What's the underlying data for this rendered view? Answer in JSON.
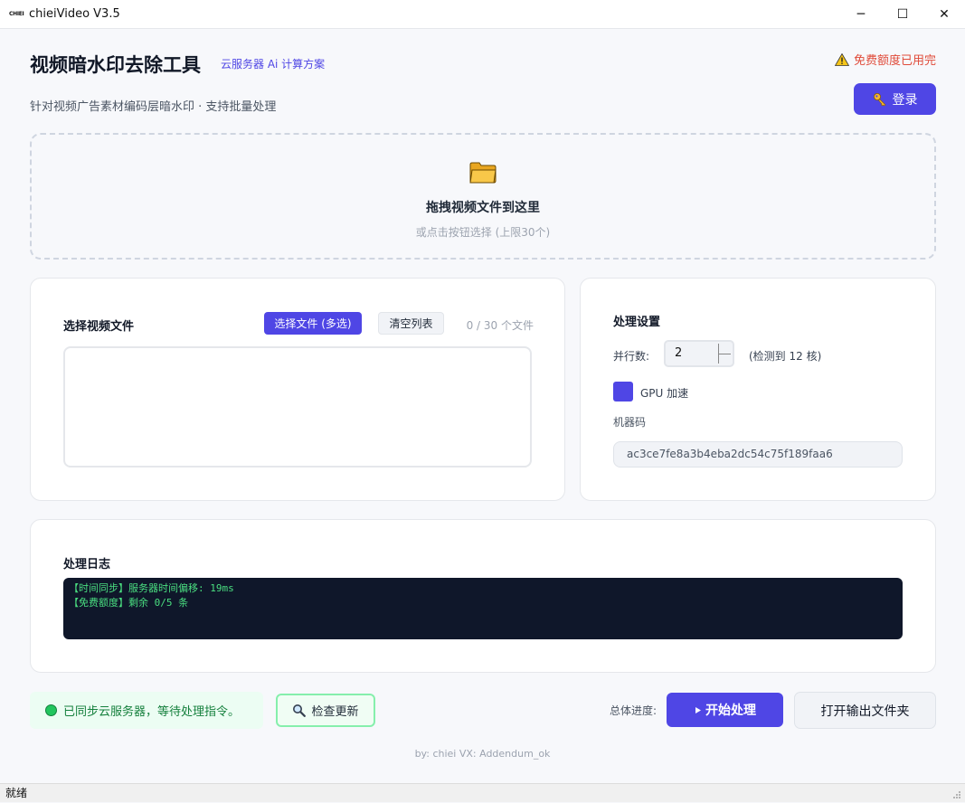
{
  "window": {
    "icon_text": "CHIEI",
    "title": "chieiVideo V3.5",
    "minimize": "─",
    "maximize": "☐",
    "close": "✕"
  },
  "header": {
    "title": "视频暗水印去除工具",
    "badge": "云服务器 Ai 计算方案",
    "subtitle": "针对视频广告素材编码层暗水印 · 支持批量处理",
    "quota_warning": "免费额度已用完",
    "login_label": "登录",
    "warning_color": "#e04b3a",
    "accent_color": "#4f46e5"
  },
  "dropzone": {
    "title": "拖拽视频文件到这里",
    "hint": "或点击按钮选择 (上限30个)"
  },
  "files": {
    "section_title": "选择视频文件",
    "select_label": "选择文件 (多选)",
    "clear_label": "清空列表",
    "count": "0 / 30 个文件",
    "items": []
  },
  "settings": {
    "section_title": "处理设置",
    "parallel_label": "并行数:",
    "parallel_value": "2",
    "parallel_note": "(检测到 12 核)",
    "gpu_label": "GPU 加速",
    "gpu_checked": true,
    "machine_code_label": "机器码",
    "machine_code": "ac3ce7fe8a3b4eba2dc54c75f189faa6"
  },
  "log": {
    "section_title": "处理日志",
    "lines": [
      "【时间同步】服务器时间偏移: 19ms",
      "【免费额度】剩余 0/5 条"
    ],
    "text_color": "#4ade80"
  },
  "footer": {
    "status_text": "已同步云服务器，等待处理指令。",
    "check_update_label": "检查更新",
    "progress_label": "总体进度:",
    "start_label": "开始处理",
    "open_output_label": "打开输出文件夹",
    "credits": "by: chiei  VX: Addendum_ok"
  },
  "statusbar": {
    "text": "就绪"
  }
}
